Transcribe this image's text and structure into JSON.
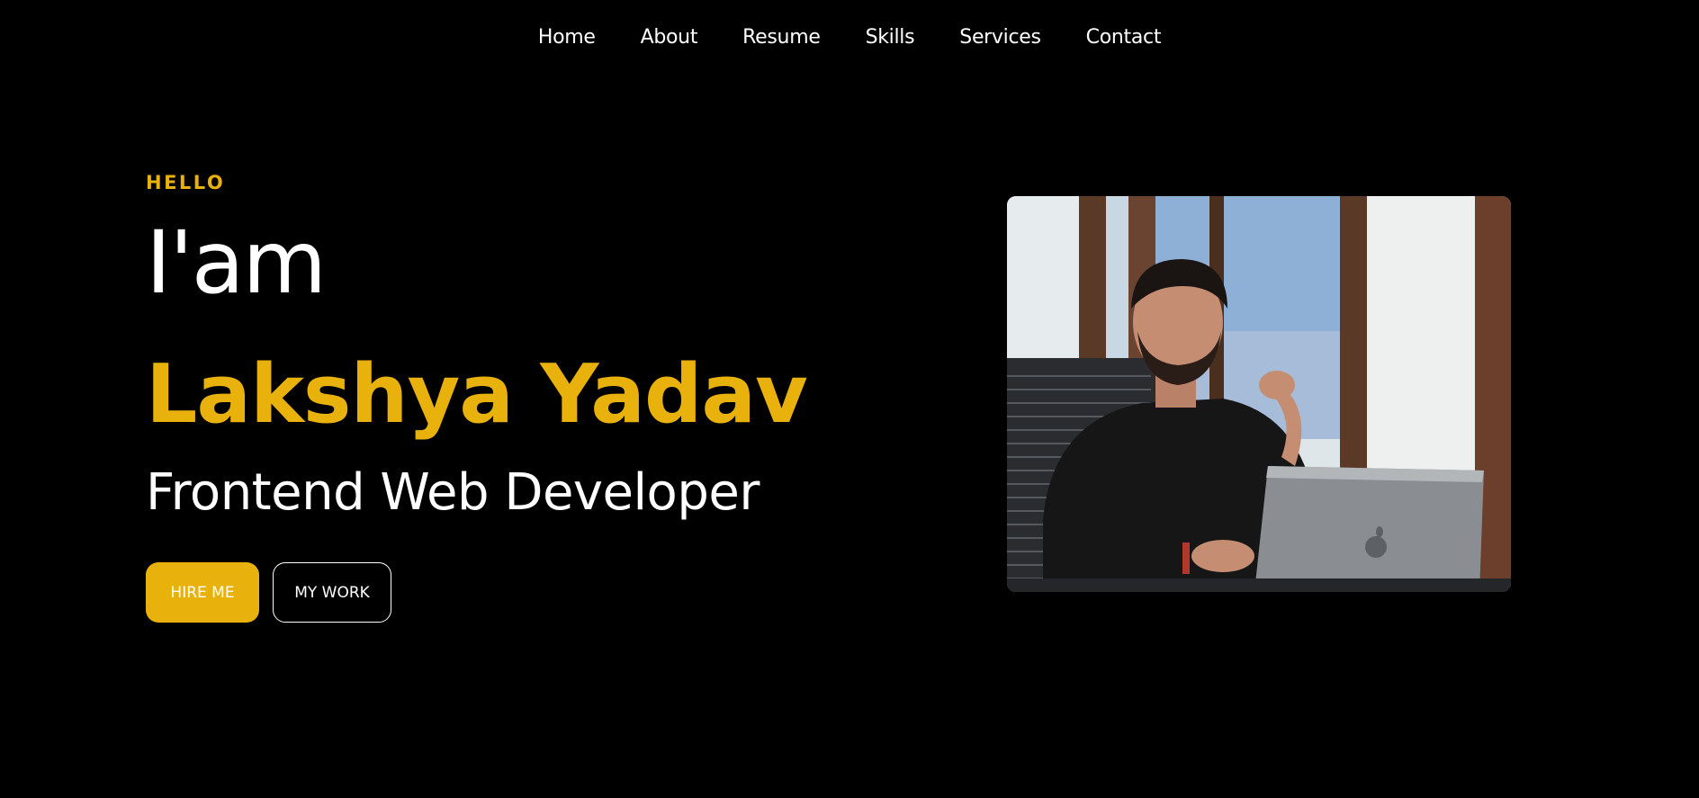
{
  "nav": {
    "items": [
      {
        "label": "Home"
      },
      {
        "label": "About"
      },
      {
        "label": "Resume"
      },
      {
        "label": "Skills"
      },
      {
        "label": "Services"
      },
      {
        "label": "Contact"
      }
    ]
  },
  "hero": {
    "greeting": "HELLO",
    "intro": "I'am",
    "name": "Lakshya Yadav",
    "role": "Frontend Web Developer",
    "buttons": {
      "hire": "HIRE ME",
      "work": "MY WORK"
    }
  },
  "colors": {
    "background": "#000000",
    "accent": "#e9b10c",
    "text": "#ffffff"
  }
}
